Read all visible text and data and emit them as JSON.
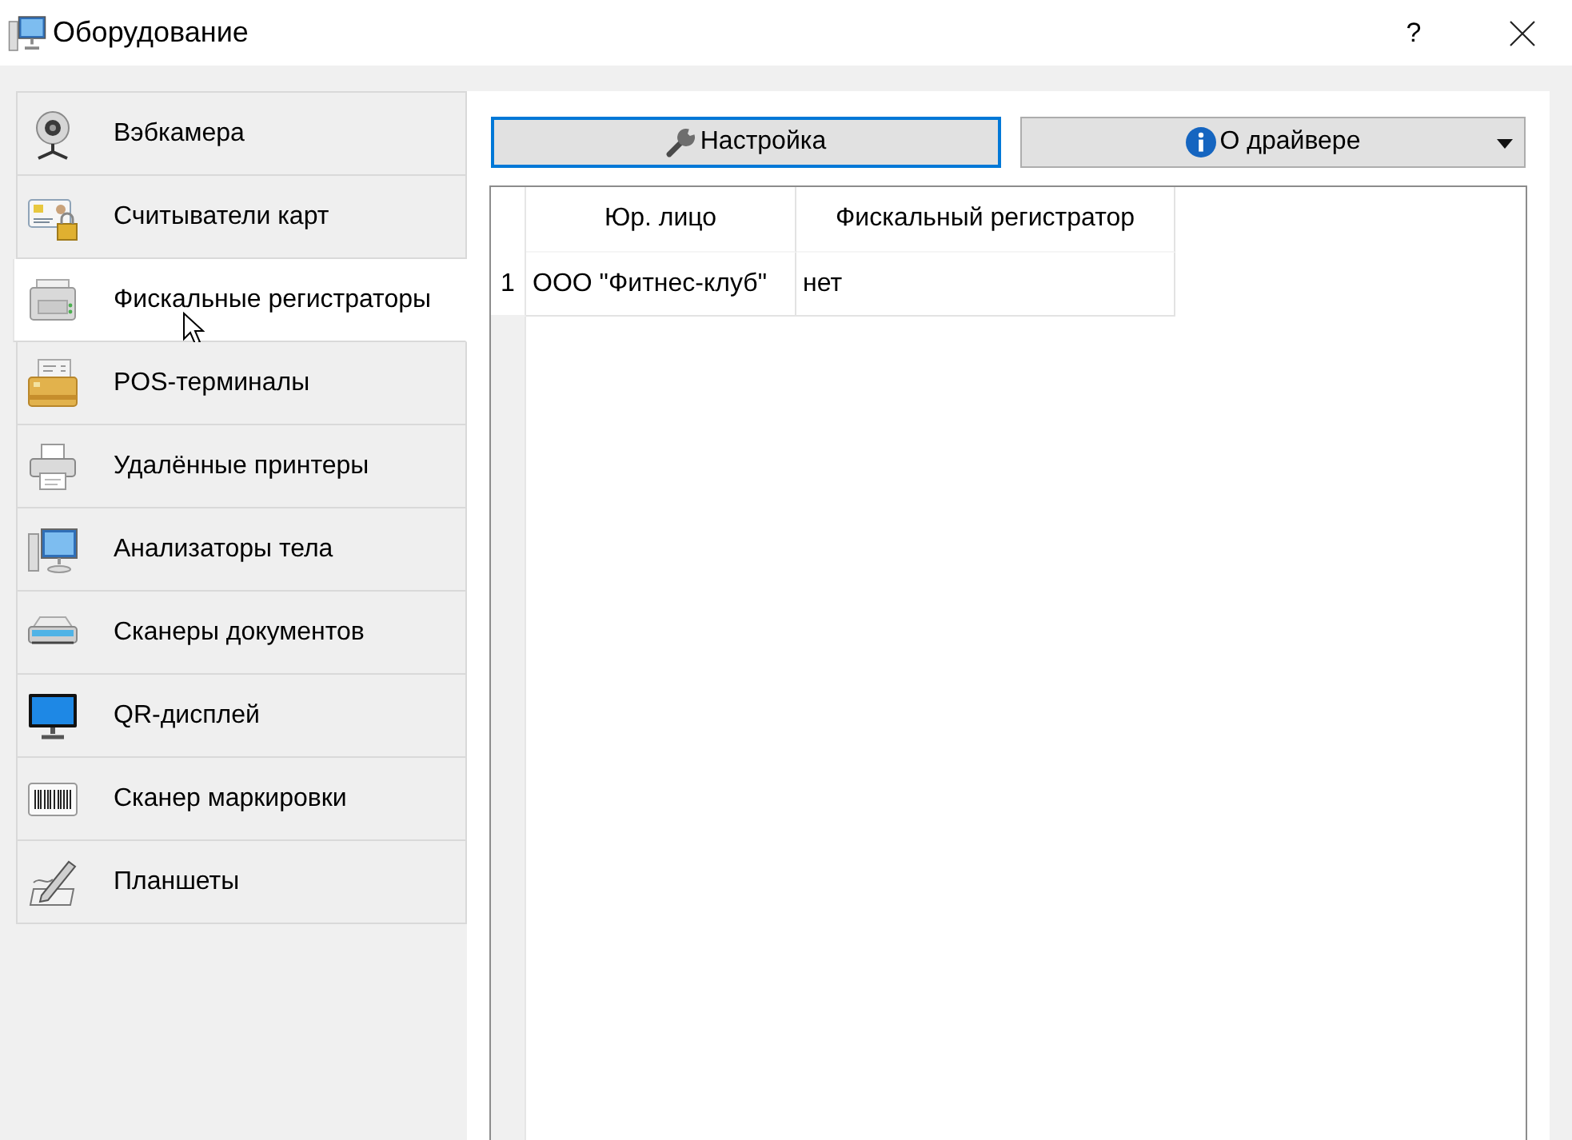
{
  "window": {
    "title": "Оборудование",
    "help_button": "?"
  },
  "sidebar": {
    "items": [
      {
        "label": "Вэбкамера",
        "selected": false
      },
      {
        "label": "Считыватели карт",
        "selected": false
      },
      {
        "label": "Фискальные регистраторы",
        "selected": true
      },
      {
        "label": "POS-терминалы",
        "selected": false
      },
      {
        "label": "Удалённые принтеры",
        "selected": false
      },
      {
        "label": "Анализаторы тела",
        "selected": false
      },
      {
        "label": "Сканеры документов",
        "selected": false
      },
      {
        "label": "QR-дисплей",
        "selected": false
      },
      {
        "label": "Сканер маркировки",
        "selected": false
      },
      {
        "label": "Планшеты",
        "selected": false
      }
    ]
  },
  "toolbar": {
    "buttons": [
      {
        "label": "Настройка",
        "focused": true,
        "dropdown": false
      },
      {
        "label": "О драйвере",
        "focused": false,
        "dropdown": true
      }
    ]
  },
  "table": {
    "columns": [
      "Юр. лицо",
      "Фискальный регистратор"
    ],
    "rows": [
      {
        "number": "1",
        "cells": [
          "ООО \"Фитнес-клуб\"",
          "нет"
        ]
      }
    ]
  }
}
